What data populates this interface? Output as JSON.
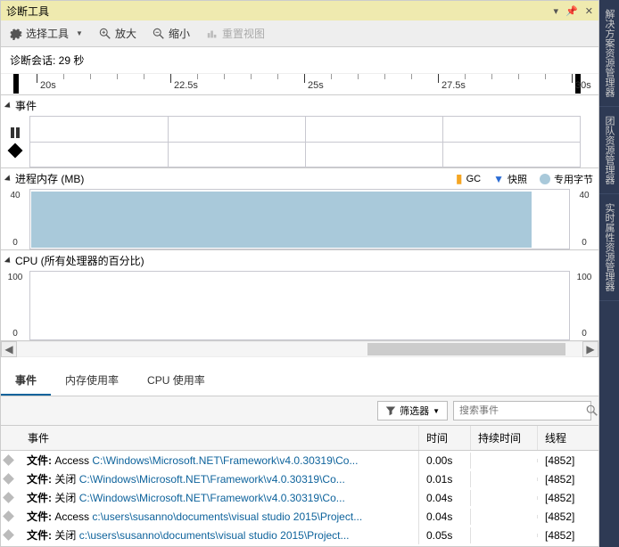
{
  "title": "诊断工具",
  "toolbar": {
    "select_tool": "选择工具",
    "zoom_in": "放大",
    "zoom_out": "缩小",
    "reset_view": "重置视图"
  },
  "session_label": "诊断会话: 29 秒",
  "ruler": {
    "ticks": [
      "20s",
      "22.5s",
      "25s",
      "27.5s",
      "30s"
    ]
  },
  "sections": {
    "events": "事件",
    "memory": "进程内存 (MB)",
    "cpu": "CPU (所有处理器的百分比)"
  },
  "legend": {
    "gc": "GC",
    "snapshot": "快照",
    "private_bytes": "专用字节"
  },
  "mem_axis": {
    "max": "40",
    "min": "0"
  },
  "cpu_axis": {
    "max": "100",
    "min": "0"
  },
  "tabs": {
    "events": "事件",
    "memory": "内存使用率",
    "cpu": "CPU 使用率"
  },
  "filter": {
    "label": "筛选器",
    "search_placeholder": "搜索事件"
  },
  "table": {
    "headers": {
      "event": "事件",
      "time": "时间",
      "duration": "持续时间",
      "thread": "线程"
    },
    "rows": [
      {
        "prefix": "文件: ",
        "action": "Access ",
        "path": "C:\\Windows\\Microsoft.NET\\Framework\\v4.0.30319\\Co...",
        "time": "0.00s",
        "duration": "",
        "thread": "[4852]"
      },
      {
        "prefix": "文件: ",
        "action": "关闭 ",
        "path": "C:\\Windows\\Microsoft.NET\\Framework\\v4.0.30319\\Co...",
        "time": "0.01s",
        "duration": "",
        "thread": "[4852]"
      },
      {
        "prefix": "文件: ",
        "action": "关闭 ",
        "path": "C:\\Windows\\Microsoft.NET\\Framework\\v4.0.30319\\Co...",
        "time": "0.04s",
        "duration": "",
        "thread": "[4852]"
      },
      {
        "prefix": "文件: ",
        "action": "Access ",
        "path": "c:\\users\\susanno\\documents\\visual studio 2015\\Project...",
        "time": "0.04s",
        "duration": "",
        "thread": "[4852]"
      },
      {
        "prefix": "文件: ",
        "action": "关闭 ",
        "path": "c:\\users\\susanno\\documents\\visual studio 2015\\Project...",
        "time": "0.05s",
        "duration": "",
        "thread": "[4852]"
      }
    ]
  },
  "side_tabs": [
    "解决方案资源管理器",
    "团队资源管理器",
    "实时属性资源管理器"
  ]
}
